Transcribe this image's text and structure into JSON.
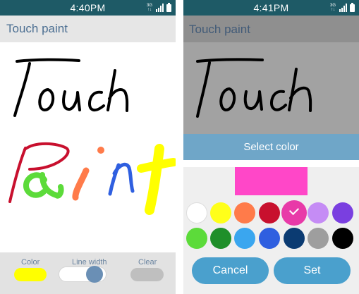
{
  "left": {
    "status": {
      "time": "4:40PM",
      "network": "3G"
    },
    "app_title": "Touch paint",
    "toolbar": {
      "color_label": "Color",
      "line_width_label": "Line width",
      "clear_label": "Clear",
      "current_color": "#ffff00"
    }
  },
  "right": {
    "status": {
      "time": "4:41PM",
      "network": "3G"
    },
    "app_title": "Touch paint",
    "dialog": {
      "title": "Select color",
      "preview_color": "#ff47c8",
      "colors_row1": [
        "#ffffff",
        "#ffff1a",
        "#ff7b4a",
        "#c8102e",
        "#e83aa8",
        "#c58cf5",
        "#7a3fe0"
      ],
      "colors_row2": [
        "#5cdb3a",
        "#1f8f2a",
        "#3aa6ef",
        "#2f5fe0",
        "#0b3b72",
        "#9e9e9e",
        "#000000"
      ],
      "selected_color": "#e83aa8",
      "cancel_label": "Cancel",
      "set_label": "Set"
    }
  }
}
